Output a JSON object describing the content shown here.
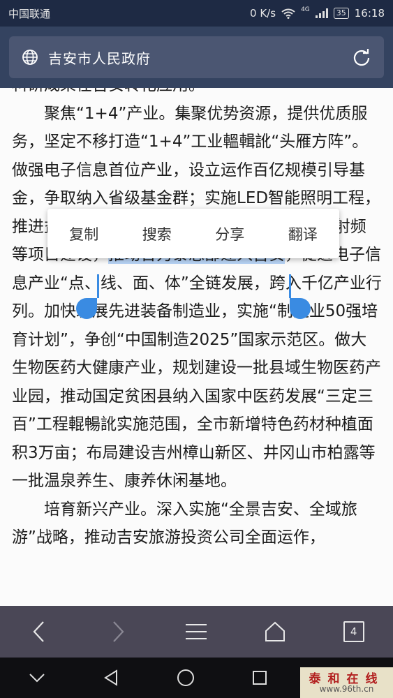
{
  "status_bar": {
    "carrier": "中国联通",
    "speed": "0 K/s",
    "network": "4G",
    "battery": "35",
    "time": "16:18"
  },
  "address_bar": {
    "title": "吉安市人民政府",
    "left_icon": "globe-icon",
    "right_icon": "refresh-icon"
  },
  "article": {
    "top_fragment": "科研成果在吉安转化应用。",
    "para1_before": "聚焦“1+4”产业。集聚优势资源，提供优质服务，坚定不移打造“1+4”工业轀輯訛“头雁方阵”。做强电子信息首位产业，设立运作百亿规模引导基金，争取纳入省级基金群；实施LED智能照明工程，推进益丰泰TFT-LCD面板、欧司朗照明、立讯射频等项目建设，",
    "para1_selected": "推动合力泰总部迁入吉安",
    "para1_after": "，促进电子信息产业“点、线、面、体”全链发展，跨入千亿产业行列。加快发展先进装备制造业，实施“制造业50强培育计划”，争创“中国制造2025”国家示范区。做大生物医药大健康产业，规划建设一批县域生物医药产业园，推动国定贫困县纳入国家中医药发展“三定三百”工程輥暢訛实施范围，全市新增特色药材种植面积3万亩；布局建设吉州樟山新区、井冈山市柏露等一批温泉养生、康养休闲基地。",
    "para2": "培育新兴产业。深入实施“全景吉安、全域旅游”战略，推动吉安旅游投资公司全面运作，"
  },
  "context_menu": {
    "items": [
      "复制",
      "搜索",
      "分享",
      "翻译"
    ]
  },
  "toolbar": {
    "tab_count": "4",
    "icons": [
      "back-icon",
      "forward-icon",
      "menu-icon",
      "home-icon",
      "tabs-icon"
    ]
  },
  "watermark": {
    "title": "泰和在线",
    "url": "www.96th.cn"
  },
  "colors": {
    "selection": "#b7d3f5",
    "handle": "#3a8be2",
    "address_bg": "#344360",
    "toolbar_bg": "#4a4756"
  }
}
